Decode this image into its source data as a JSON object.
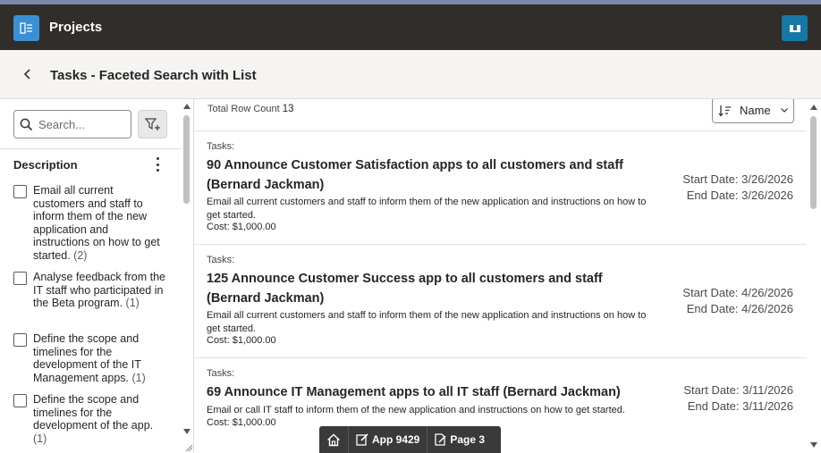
{
  "header": {
    "app_title": "Projects",
    "app_icon": "app-icon",
    "user_initials": "‖‖"
  },
  "page": {
    "title": "Tasks - Faceted Search with List"
  },
  "facets": {
    "search_placeholder": "Search...",
    "group_title": "Description",
    "options": [
      {
        "label": "Email all current customers and staff to inform them of the new application and instructions on how to get started.",
        "count": "(2)"
      },
      {
        "label": "Analyse feedback from the IT staff who participated in the Beta program.",
        "count": "(1)"
      },
      {
        "label": "Define the scope and timelines for the development of the IT Management apps.",
        "count": "(1)"
      },
      {
        "label": "Define the scope and timelines for the development of the app.",
        "count": "(1)"
      }
    ]
  },
  "results": {
    "row_count_label": "Total Row Count",
    "row_count": "13",
    "sort_label": "Name",
    "cards": [
      {
        "kicker": "Tasks:",
        "title": "90 Announce Customer Satisfaction apps to all customers and staff (Bernard Jackman)",
        "body": "Email all current customers and staff to inform them of the new application and instructions on how to get started.",
        "cost": "Cost: $1,000.00",
        "start": "Start Date: 3/26/2026",
        "end": "End Date: 3/26/2026"
      },
      {
        "kicker": "Tasks:",
        "title": "125 Announce Customer Success app to all customers and staff (Bernard Jackman)",
        "body": "Email all current customers and staff to inform them of the new application and instructions on how to get started.",
        "cost": "Cost: $1,000.00",
        "start": "Start Date: 4/26/2026",
        "end": "End Date: 4/26/2026"
      },
      {
        "kicker": "Tasks:",
        "title": "69 Announce IT Management apps to all IT staff (Bernard Jackman)",
        "body": "Email or call IT staff to inform them of the new application and instructions on how to get started.",
        "cost": "Cost: $1,000.00",
        "start": "Start Date: 3/11/2026",
        "end": "End Date: 3/11/2026"
      }
    ]
  },
  "dev_toolbar": {
    "home_icon": "home-icon",
    "app_label": "App 9429",
    "page_label": "Page 3"
  },
  "colors": {
    "header_bg": "#312d2a",
    "app_icon_bg": "#3a8fd6",
    "user_icon_bg": "#1778a6",
    "title_bar_bg": "#f5f4f2",
    "dev_toolbar_bg": "#3a3a3a"
  }
}
